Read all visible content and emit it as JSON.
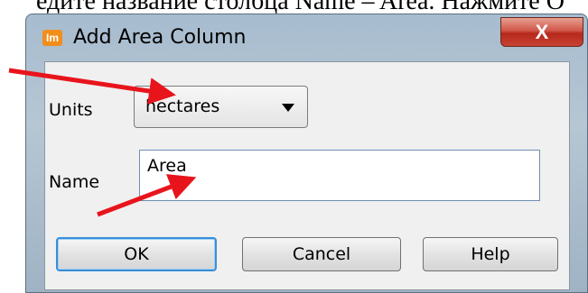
{
  "document": {
    "partial_text": "едите название столбца Name – Area. Нажмите О"
  },
  "dialog": {
    "app_icon_text": "Im",
    "title": "Add Area Column",
    "close_symbol": "X",
    "units_label": "Units",
    "units_value": "hectares",
    "name_label": "Name",
    "name_value": "Area",
    "ok_label": "OK",
    "cancel_label": "Cancel",
    "help_label": "Help"
  },
  "colors": {
    "annotation_arrow": "#e8141c",
    "ok_focus": "#3a8fd6",
    "close_button": "#c8412f"
  }
}
